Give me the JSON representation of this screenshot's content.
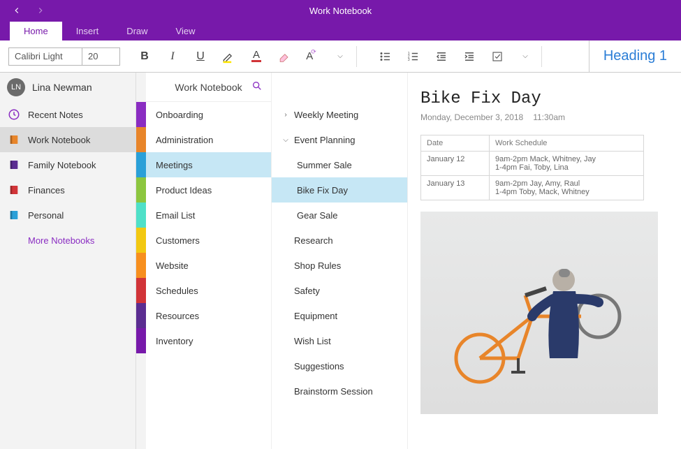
{
  "window": {
    "title": "Work Notebook"
  },
  "ribbon": {
    "tabs": [
      "Home",
      "Insert",
      "Draw",
      "View"
    ],
    "active": 0
  },
  "toolbar": {
    "font_name": "Calibri Light",
    "font_size": "20",
    "heading_style": "Heading 1"
  },
  "user": {
    "initials": "LN",
    "name": "Lina Newman"
  },
  "notebooks": {
    "items": [
      {
        "label": "Recent Notes",
        "icon": "clock",
        "color": "#8a2dc2"
      },
      {
        "label": "Work Notebook",
        "icon": "notebook",
        "color": "#e8852a",
        "active": true
      },
      {
        "label": "Family Notebook",
        "icon": "notebook",
        "color": "#5b2d91"
      },
      {
        "label": "Finances",
        "icon": "notebook",
        "color": "#d13438"
      },
      {
        "label": "Personal",
        "icon": "notebook",
        "color": "#2aa0d8"
      }
    ],
    "more_label": "More Notebooks"
  },
  "tab_colors": [
    "#8a2dc2",
    "#e8852a",
    "#2aa0d8",
    "#8cc63f",
    "#4fe0c8",
    "#f2c811",
    "#f78f1e",
    "#d13438",
    "#5b2d91",
    "#7719AA"
  ],
  "sections": {
    "header": "Work Notebook",
    "items": [
      "Onboarding",
      "Administration",
      "Meetings",
      "Product Ideas",
      "Email List",
      "Customers",
      "Website",
      "Schedules",
      "Resources",
      "Inventory"
    ],
    "active": 2
  },
  "pages": {
    "items": [
      {
        "label": "Weekly Meeting",
        "expand": "collapsed"
      },
      {
        "label": "Event Planning",
        "expand": "expanded"
      },
      {
        "label": "Summer Sale",
        "child": true
      },
      {
        "label": "Bike Fix Day",
        "child": true,
        "active": true
      },
      {
        "label": "Gear Sale",
        "child": true
      },
      {
        "label": "Research"
      },
      {
        "label": "Shop Rules"
      },
      {
        "label": "Safety"
      },
      {
        "label": "Equipment"
      },
      {
        "label": "Wish List"
      },
      {
        "label": "Suggestions"
      },
      {
        "label": "Brainstorm Session"
      }
    ]
  },
  "note": {
    "title": "Bike Fix Day",
    "date": "Monday, December 3, 2018",
    "time": "11:30am",
    "table": {
      "headers": [
        "Date",
        "Work Schedule"
      ],
      "rows": [
        [
          "January 12",
          "9am-2pm Mack, Whitney, Jay\n1-4pm Fai, Toby, Lina"
        ],
        [
          "January 13",
          "9am-2pm Jay, Amy, Raul\n1-4pm Toby, Mack, Whitney"
        ]
      ]
    }
  }
}
